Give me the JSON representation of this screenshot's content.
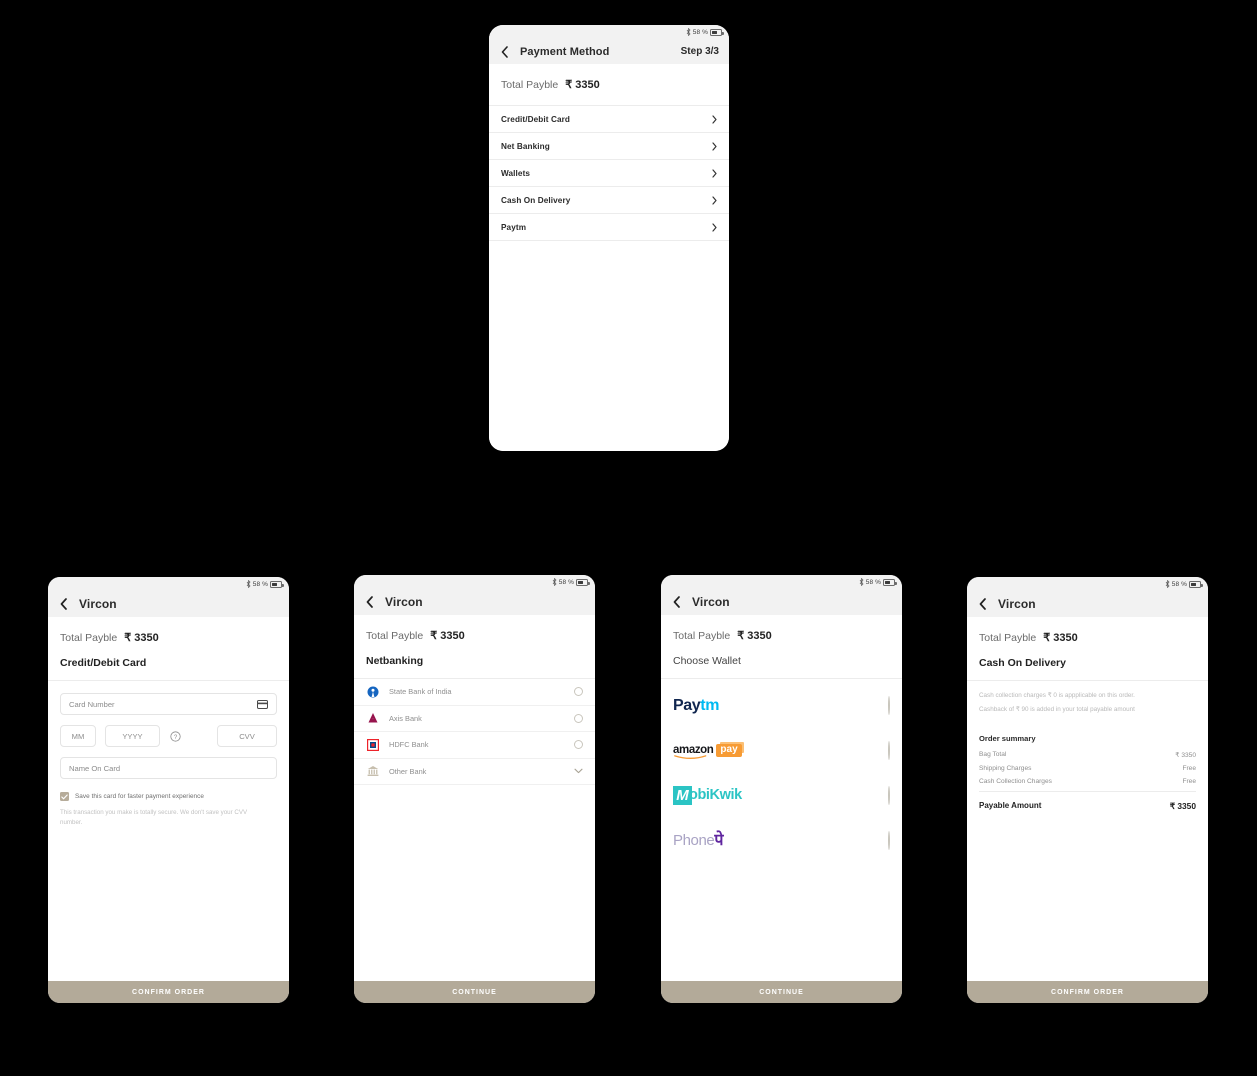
{
  "status_bar": {
    "battery_percent": "58 %",
    "bluetooth_icon": "bluetooth-icon",
    "battery_icon": "battery-icon"
  },
  "colors": {
    "cta": "#b3aa99",
    "header_bg": "#f2f2f2",
    "checkbox": "#b6ac9a",
    "paytm_dark": "#10264f",
    "paytm_cyan": "#00baf2",
    "amazon_orange": "#f79b34",
    "mobikwik_teal": "#2bc4c4",
    "phonepe_purple": "#5f259f",
    "sbi_blue": "#1565c0",
    "axis_maroon": "#97144d",
    "hdfc_red": "#ed232a"
  },
  "payment_method_screen": {
    "back_icon": "back-chevron-icon",
    "title": "Payment Method",
    "step": "Step 3/3",
    "total_label": "Total Payble",
    "total_amount": "₹ 3350",
    "methods": [
      {
        "label": "Credit/Debit Card",
        "chevron": "chevron-right-icon"
      },
      {
        "label": "Net Banking",
        "chevron": "chevron-right-icon"
      },
      {
        "label": "Wallets",
        "chevron": "chevron-right-icon"
      },
      {
        "label": "Cash On Delivery",
        "chevron": "chevron-right-icon"
      },
      {
        "label": "Paytm",
        "chevron": "chevron-right-icon"
      }
    ]
  },
  "card_screen": {
    "back_icon": "back-chevron-icon",
    "title": "Vircon",
    "total_label": "Total Payble",
    "total_amount": "₹ 3350",
    "section_title": "Credit/Debit Card",
    "card_number_placeholder": "Card Number",
    "card_icon": "credit-card-icon",
    "month_placeholder": "MM",
    "year_placeholder": "YYYY",
    "help_icon": "help-circle-icon",
    "cvv_placeholder": "CVV",
    "name_placeholder": "Name On Card",
    "save_card_label": "Save this card for faster payment experience",
    "save_card_checked": true,
    "secure_note": "This transaction you make is totally secure. We don't save your CVV number.",
    "cta_label": "CONFIRM ORDER"
  },
  "netbanking_screen": {
    "back_icon": "back-chevron-icon",
    "title": "Vircon",
    "total_label": "Total Payble",
    "total_amount": "₹ 3350",
    "section_title": "Netbanking",
    "banks": [
      {
        "name": "State Bank of India",
        "logo": "sbi-logo-icon",
        "control": "radio-unselected"
      },
      {
        "name": "Axis Bank",
        "logo": "axis-bank-logo-icon",
        "control": "radio-unselected"
      },
      {
        "name": "HDFC Bank",
        "logo": "hdfc-bank-logo-icon",
        "control": "radio-unselected"
      },
      {
        "name": "Other Bank",
        "logo": "bank-building-icon",
        "control": "chevron-down-icon"
      }
    ],
    "cta_label": "CONTINUE"
  },
  "wallet_screen": {
    "back_icon": "back-chevron-icon",
    "title": "Vircon",
    "total_label": "Total Payble",
    "total_amount": "₹ 3350",
    "section_title": "Choose Wallet",
    "wallets": [
      {
        "name": "Paytm",
        "logo": "paytm-logo-icon",
        "part1": "Pay",
        "part2": "tm",
        "control": "radio-unselected"
      },
      {
        "name": "Amazon Pay",
        "logo": "amazon-pay-logo-icon",
        "part1": "amazon",
        "part2": "pay",
        "control": "radio-unselected"
      },
      {
        "name": "MobiKwik",
        "logo": "mobikwik-logo-icon",
        "part1": "M",
        "part2": "obiKwik",
        "control": "radio-unselected"
      },
      {
        "name": "PhonePe",
        "logo": "phonepe-logo-icon",
        "part1": "Phone",
        "part2": "पे",
        "control": "radio-unselected"
      }
    ],
    "cta_label": "CONTINUE"
  },
  "cod_screen": {
    "back_icon": "back-chevron-icon",
    "title": "Vircon",
    "total_label": "Total Payble",
    "total_amount": "₹ 3350",
    "section_title": "Cash On Delivery",
    "note1": "Cash collection charges ₹ 0 is appplicable on this order.",
    "note2": "Cashback of ₹ 90 is added in your total payable amount",
    "summary_title": "Order summary",
    "summary_rows": [
      {
        "key": "Bag Total",
        "value": "₹ 3350"
      },
      {
        "key": "Shipping Charges",
        "value": "Free"
      },
      {
        "key": "Cash Collection Charges",
        "value": "Free"
      }
    ],
    "payable_label": "Payable Amount",
    "payable_value": "₹ 3350",
    "cta_label": "CONFIRM ORDER"
  }
}
